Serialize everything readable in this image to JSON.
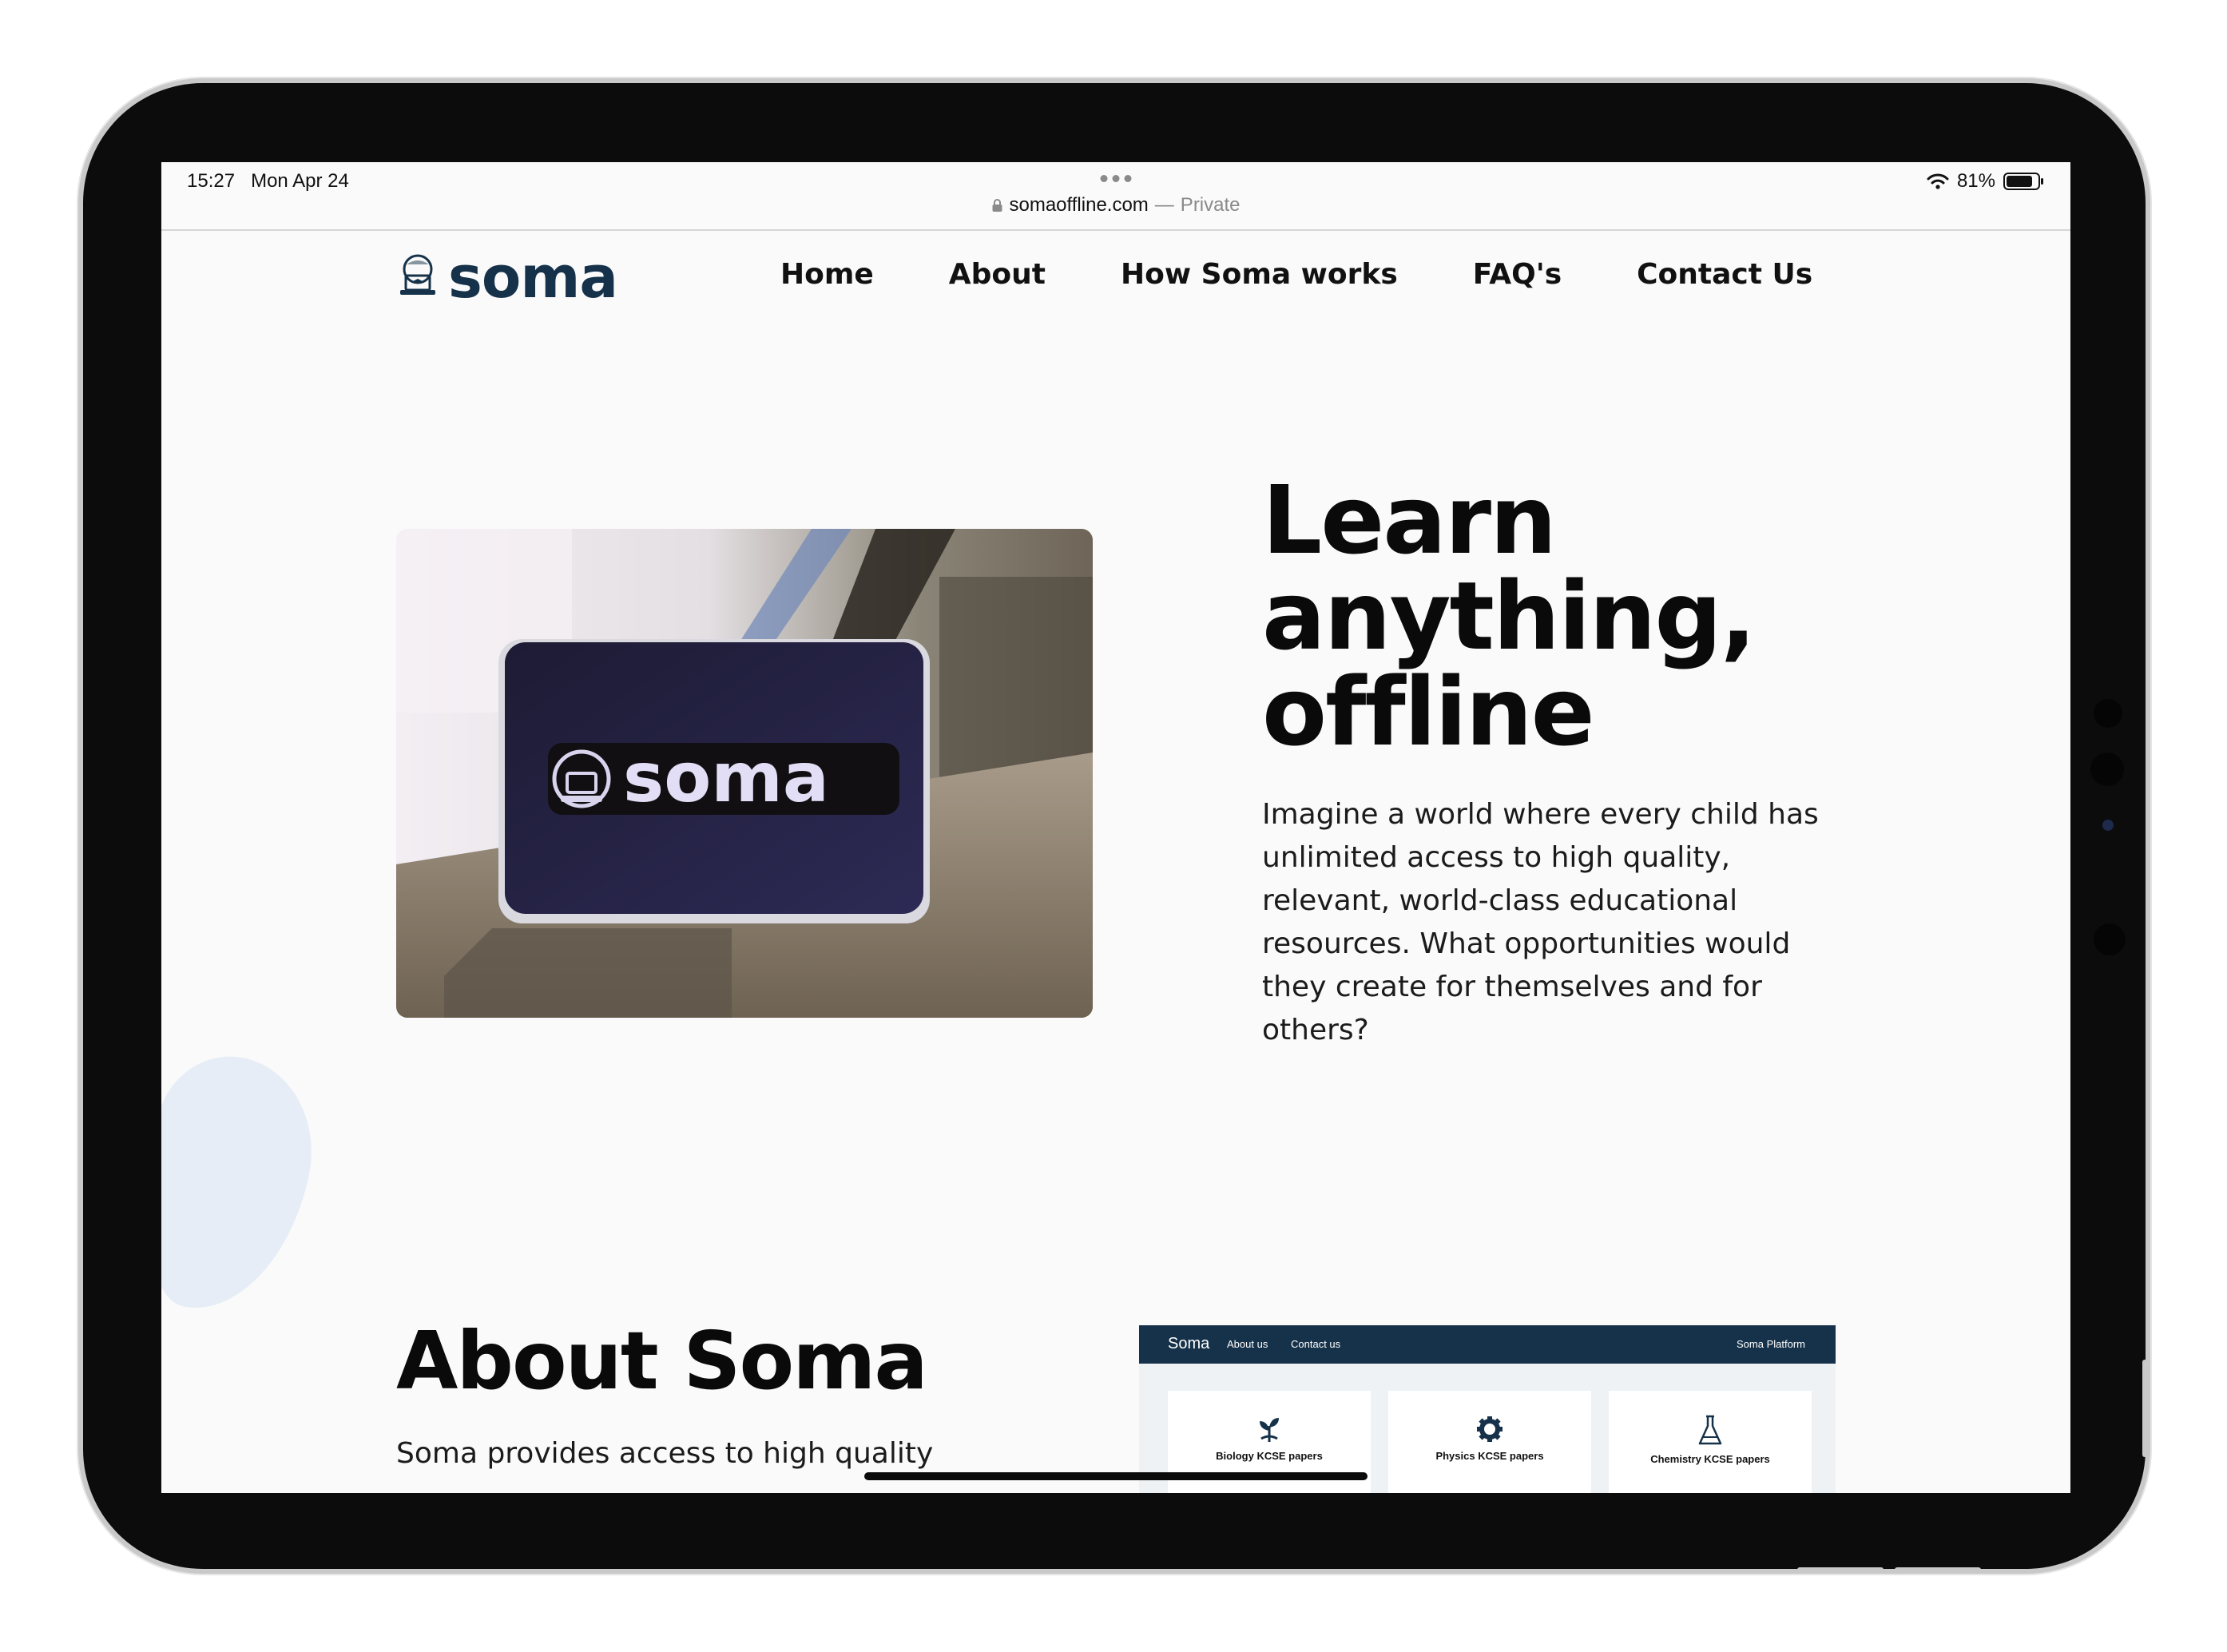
{
  "status_bar": {
    "time": "15:27",
    "date": "Mon Apr 24",
    "battery": "81%",
    "url": "somaoffline.com",
    "separator": "—",
    "private_label": "Private"
  },
  "logo": {
    "text": "soma"
  },
  "nav": {
    "items": [
      {
        "label": "Home"
      },
      {
        "label": "About"
      },
      {
        "label": "How Soma works"
      },
      {
        "label": "FAQ's"
      },
      {
        "label": "Contact Us"
      }
    ]
  },
  "hero": {
    "title_line1": "Learn",
    "title_line2": "anything,",
    "title_line3": "offline",
    "description": "Imagine a world where every child has unlimited access to high quality, relevant, world-class educational resources. What opportunities would they create for themselves and for others?",
    "photo_logo_text": "soma"
  },
  "about": {
    "title": "About Soma",
    "text": "Soma provides access to high quality"
  },
  "preview": {
    "brand": "Soma",
    "links": [
      "About us",
      "Contact us"
    ],
    "right_label": "Soma Platform",
    "cards": [
      {
        "label": "Biology KCSE papers",
        "icon": "plant-icon"
      },
      {
        "label": "Physics KCSE papers",
        "icon": "gear-icon"
      },
      {
        "label": "Chemistry KCSE papers",
        "icon": "flask-icon"
      }
    ]
  },
  "colors": {
    "brand_navy": "#16324a",
    "page_bg": "#fafafa",
    "text_dark": "#0a0a0a",
    "blob": "#e6edf6"
  }
}
